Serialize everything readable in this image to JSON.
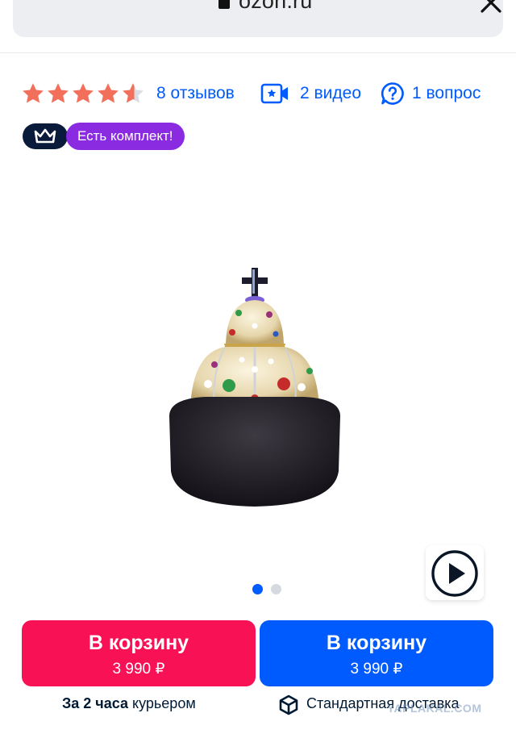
{
  "browser": {
    "url": "ozon.ru",
    "lock_icon": "lock-icon",
    "close_icon": "close-icon"
  },
  "rating": {
    "stars": 4.5,
    "max": 5,
    "star_color": "#f26f5b"
  },
  "stats": {
    "reviews": "8 отзывов",
    "videos": "2 видео",
    "questions": "1 вопрос"
  },
  "badges": {
    "kit": "Есть комплект!",
    "crown_icon": "crown-icon"
  },
  "gallery": {
    "slides": 2,
    "active_slide": 1,
    "play_icon": "play-icon"
  },
  "cart": {
    "red": {
      "label": "В корзину",
      "price": "3 990 ₽",
      "color": "#f91155"
    },
    "blue": {
      "label": "В корзину",
      "price": "3 990 ₽",
      "color": "#005bff"
    }
  },
  "delivery": {
    "fast_bold": "За 2 часа",
    "fast_rest": "курьером",
    "standard": "Стандартная доставка",
    "box_icon": "box-icon"
  },
  "watermark": "YAPLAKAL.COM"
}
